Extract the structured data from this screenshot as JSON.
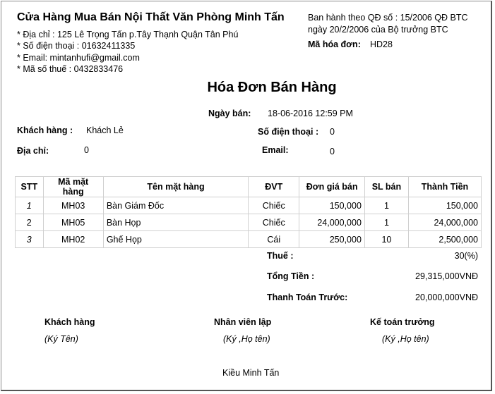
{
  "store": {
    "name": "Cửa Hàng Mua Bán Nội Thất Văn Phòng Minh Tấn",
    "address": "* Địa chỉ : 125 Lê Trọng Tấn p.Tây Thạnh Quận Tân Phú",
    "phone": "* Số điện thoại : 01632411335",
    "email": "* Email: mintanhufi@gmail.com",
    "tax_code": "* Mã số thuế : 0432833476"
  },
  "regulation": {
    "line1": "Ban hành theo QĐ số : 15/2006 QĐ BTC",
    "line2": "ngày 20/2/2006 của Bộ trưởng BTC",
    "invoice_code_label": "Mã hóa đơn:",
    "invoice_code": "HD28"
  },
  "invoice": {
    "title": "Hóa Đơn Bán Hàng",
    "date_label": "Ngày bán:",
    "date": "18-06-2016 12:59 PM"
  },
  "customer": {
    "name_label": "Khách hàng :",
    "name": "Khách Lẻ",
    "phone_label": "Số điện thoại :",
    "phone": "0",
    "address_label": "Địa chỉ:",
    "address": "0",
    "email_label": "Email:",
    "email": "0"
  },
  "table": {
    "headers": [
      "STT",
      "Mã mặt hàng",
      "Tên mặt hàng",
      "ĐVT",
      "Đơn giá bán",
      "SL bán",
      "Thành Tiền"
    ],
    "rows": [
      [
        "1",
        "MH03",
        "Bàn Giám Đốc",
        "Chiếc",
        "150,000",
        "1",
        "150,000"
      ],
      [
        "2",
        "MH05",
        "Bàn Họp",
        "Chiếc",
        "24,000,000",
        "1",
        "24,000,000"
      ],
      [
        "3",
        "MH02",
        "Ghế Họp",
        "Cái",
        "250,000",
        "10",
        "2,500,000"
      ]
    ]
  },
  "totals": {
    "tax_label": "Thuế :",
    "tax": "30(%)",
    "total_label": "Tổng Tiền :",
    "total": "29,315,000VNĐ",
    "prepaid_label": "Thanh Toán Trước:",
    "prepaid": "20,000,000VNĐ"
  },
  "signatures": {
    "customer_label": "Khách hàng",
    "customer_sign": "(Ký Tên)",
    "staff_label": "Nhân viên lập",
    "staff_sign": "(Ký ,Họ tên)",
    "accountant_label": "Kế toán trưởng",
    "accountant_sign": "(Ký ,Họ tên)",
    "staff_name": "Kiều Minh Tấn"
  }
}
